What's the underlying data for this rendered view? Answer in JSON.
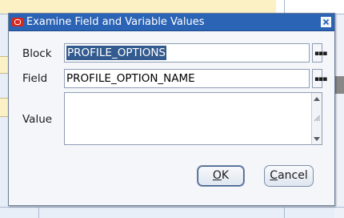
{
  "dialog": {
    "title": "Examine Field and Variable Values"
  },
  "form": {
    "block_label": "Block",
    "block_value": "PROFILE_OPTIONS",
    "field_label": "Field",
    "field_value": "PROFILE_OPTION_NAME",
    "value_label": "Value",
    "value_value": ""
  },
  "buttons": {
    "ok_label": "OK",
    "ok_mnemonic_rest": "K",
    "ok_mnemonic": "O",
    "cancel_mnemonic": "C",
    "cancel_rest": "ancel"
  },
  "icons": {
    "app": "oracle-app-icon",
    "close": "close-icon",
    "lov": "ellipsis-icon"
  },
  "colors": {
    "titlebar": "#2b63b5",
    "selection": "#335b8f",
    "oracle_red": "#d42a1f"
  }
}
